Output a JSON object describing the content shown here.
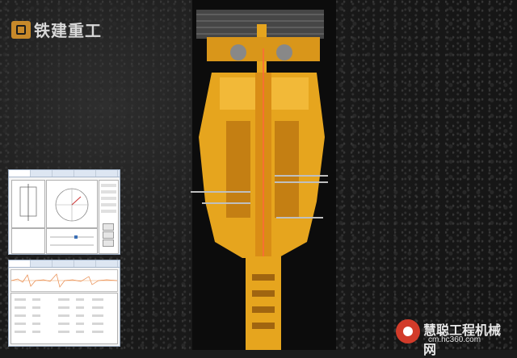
{
  "brand": {
    "name": "铁建重工",
    "accent": "#c7892a"
  },
  "watermark": {
    "name": "慧聪工程机械网",
    "url": "cm.hc360.com",
    "color": "#d23b2a"
  },
  "panel_top": {
    "tabs": [
      "",
      "",
      "",
      "",
      ""
    ]
  },
  "panel_bottom": {
    "tabs": [
      "",
      "",
      "",
      "",
      ""
    ]
  },
  "machine": {
    "color": "#e6a51e"
  }
}
